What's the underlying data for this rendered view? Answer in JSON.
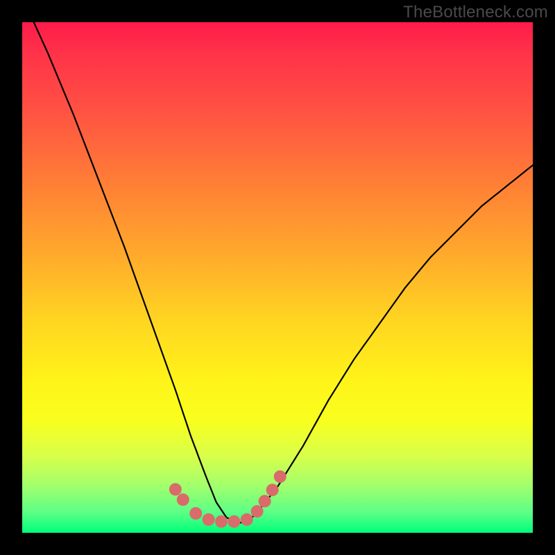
{
  "watermark": "TheBottleneck.com",
  "chart_data": {
    "type": "line",
    "title": "",
    "xlabel": "",
    "ylabel": "",
    "xlim": [
      0,
      100
    ],
    "ylim": [
      0,
      100
    ],
    "series": [
      {
        "name": "bottleneck-curve",
        "x": [
          0,
          5,
          10,
          15,
          20,
          25,
          30,
          33,
          36,
          38,
          40,
          42,
          44,
          46,
          50,
          55,
          60,
          65,
          70,
          75,
          80,
          85,
          90,
          95,
          100
        ],
        "y": [
          105,
          94,
          82,
          69,
          56,
          42,
          28,
          19,
          11,
          6,
          3,
          2,
          2,
          4,
          9,
          17,
          26,
          34,
          41,
          48,
          54,
          59,
          64,
          68,
          72
        ]
      }
    ],
    "highlight_points": {
      "x": [
        30,
        31.5,
        34,
        36.5,
        39,
        41.5,
        44,
        46,
        47.5,
        49,
        50.5
      ],
      "y": [
        8.5,
        6.5,
        3.8,
        2.6,
        2.2,
        2.2,
        2.6,
        4.2,
        6.2,
        8.4,
        11
      ]
    },
    "background_gradient": {
      "type": "vertical",
      "stops": [
        {
          "pos": 0.0,
          "color": "#ff1b49"
        },
        {
          "pos": 0.18,
          "color": "#ff5442"
        },
        {
          "pos": 0.45,
          "color": "#ffa82c"
        },
        {
          "pos": 0.7,
          "color": "#fff319"
        },
        {
          "pos": 0.85,
          "color": "#d8ff4a"
        },
        {
          "pos": 1.0,
          "color": "#00ff7a"
        }
      ]
    },
    "curve_color": "#000000",
    "highlight_color": "#d96b6b"
  }
}
